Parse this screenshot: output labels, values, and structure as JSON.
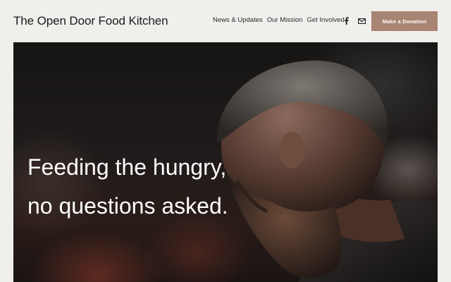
{
  "site": {
    "title": "The Open Door Food Kitchen"
  },
  "nav": {
    "items": [
      {
        "label": "News & Updates"
      },
      {
        "label": "Our Mission"
      },
      {
        "label": "Get Involved"
      }
    ]
  },
  "social": {
    "icons": [
      "facebook-icon",
      "email-icon"
    ]
  },
  "cta": {
    "donate_label": "Make a Donation",
    "color": "#a88472"
  },
  "hero": {
    "heading_line1": "Feeding the hungry,",
    "heading_line2": "no questions asked."
  },
  "colors": {
    "page_bg": "#f0efec",
    "text": "#1b1b1b",
    "hero_text": "#ffffff"
  }
}
